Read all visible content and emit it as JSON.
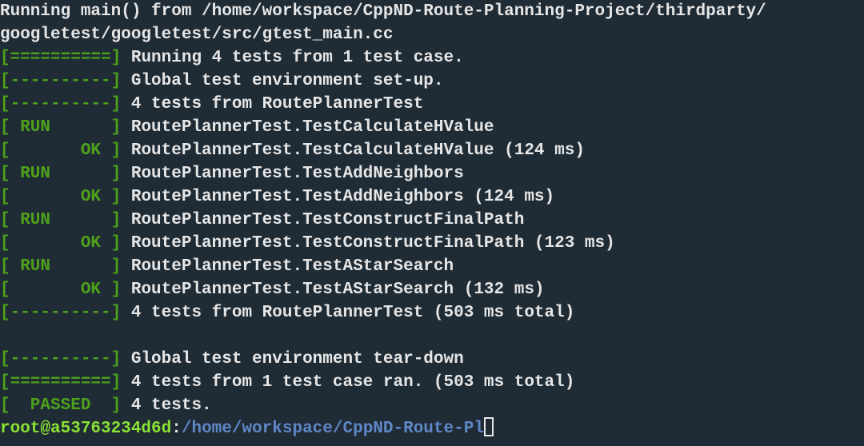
{
  "colors": {
    "background": "#1f2b35",
    "text": "#e6e6e6",
    "tag_green": "#4ea11b",
    "prompt_user": "#8ae234",
    "prompt_path": "#5f87c7"
  },
  "lines": [
    {
      "tag": "",
      "msg": "Running main() from /home/workspace/CppND-Route-Planning-Project/thirdparty/"
    },
    {
      "tag": "",
      "msg": "googletest/googletest/src/gtest_main.cc"
    },
    {
      "tag": "[==========]",
      "msg": " Running 4 tests from 1 test case."
    },
    {
      "tag": "[----------]",
      "msg": " Global test environment set-up."
    },
    {
      "tag": "[----------]",
      "msg": " 4 tests from RoutePlannerTest"
    },
    {
      "tag": "[ RUN      ]",
      "msg": " RoutePlannerTest.TestCalculateHValue"
    },
    {
      "tag": "[       OK ]",
      "msg": " RoutePlannerTest.TestCalculateHValue (124 ms)"
    },
    {
      "tag": "[ RUN      ]",
      "msg": " RoutePlannerTest.TestAddNeighbors"
    },
    {
      "tag": "[       OK ]",
      "msg": " RoutePlannerTest.TestAddNeighbors (124 ms)"
    },
    {
      "tag": "[ RUN      ]",
      "msg": " RoutePlannerTest.TestConstructFinalPath"
    },
    {
      "tag": "[       OK ]",
      "msg": " RoutePlannerTest.TestConstructFinalPath (123 ms)"
    },
    {
      "tag": "[ RUN      ]",
      "msg": " RoutePlannerTest.TestAStarSearch"
    },
    {
      "tag": "[       OK ]",
      "msg": " RoutePlannerTest.TestAStarSearch (132 ms)"
    },
    {
      "tag": "[----------]",
      "msg": " 4 tests from RoutePlannerTest (503 ms total)"
    },
    {
      "tag": "",
      "msg": ""
    },
    {
      "tag": "[----------]",
      "msg": " Global test environment tear-down"
    },
    {
      "tag": "[==========]",
      "msg": " 4 tests from 1 test case ran. (503 ms total)"
    },
    {
      "tag": "[  PASSED  ]",
      "msg": " 4 tests."
    }
  ],
  "prompt": {
    "user_host": "root@a53763234d6d",
    "separator": ":",
    "path": "/home/workspace/CppND-Route-Pl"
  }
}
